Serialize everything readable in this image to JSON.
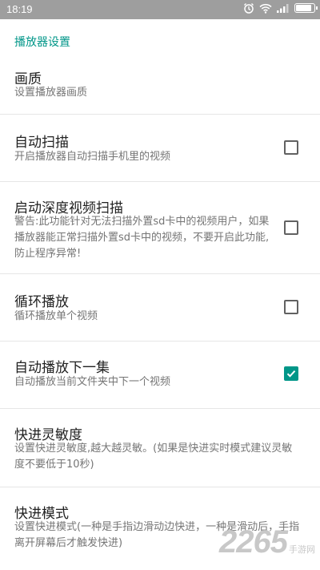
{
  "status_bar": {
    "time": "18:19",
    "icons": [
      "alarm-icon",
      "wifi-icon",
      "signal-icon",
      "battery-icon"
    ]
  },
  "section_title": "播放器设置",
  "preferences": [
    {
      "title": "画质",
      "summary": "设置播放器画质"
    },
    {
      "title": "自动扫描",
      "summary": "开启播放器自动扫描手机里的视频",
      "checked": false
    },
    {
      "title": "启动深度视频扫描",
      "summary": "警告:此功能针对无法扫描外置sd卡中的视频用户，如果播放器能正常扫描外置sd卡中的视频，不要开启此功能,防止程序异常!",
      "checked": false
    },
    {
      "title": "循环播放",
      "summary": "循环播放单个视频",
      "checked": false
    },
    {
      "title": "自动播放下一集",
      "summary": "自动播放当前文件夹中下一个视频",
      "checked": true
    },
    {
      "title": "快进灵敏度",
      "summary": "设置快进灵敏度,越大越灵敏。(如果是快进实时模式建议灵敏度不要低于10秒)"
    },
    {
      "title": "快进模式",
      "summary": "设置快进模式(一种是手指边滑动边快进，一种是滑动后，手指离开屏幕后才触发快进)"
    }
  ],
  "watermark": {
    "number": "2265",
    "text": "手游网"
  },
  "colors": {
    "accent": "#009688",
    "status_bar": "#9e9e9e"
  }
}
